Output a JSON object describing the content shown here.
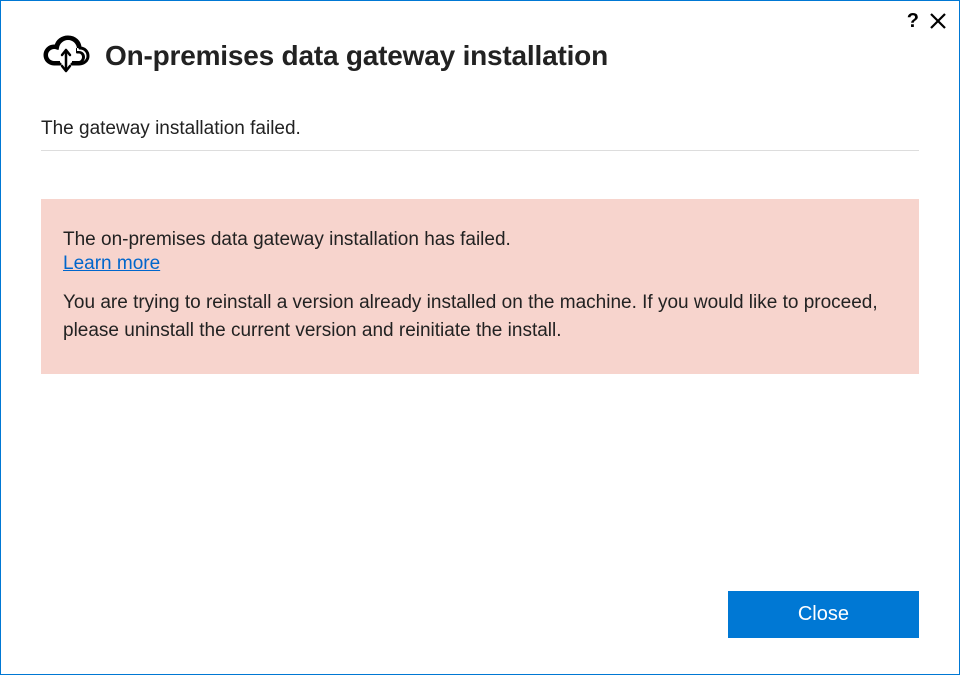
{
  "header": {
    "title": "On-premises data gateway installation"
  },
  "status": {
    "message": "The gateway installation failed."
  },
  "error": {
    "heading": "The on-premises data gateway installation has failed.",
    "learn_more_label": "Learn more",
    "detail": "You are trying to reinstall a version already installed on the machine. If you would like to proceed, please uninstall the current version and reinitiate the install."
  },
  "footer": {
    "close_label": "Close"
  },
  "titlebar": {
    "help_label": "?",
    "close_label": "✕"
  }
}
